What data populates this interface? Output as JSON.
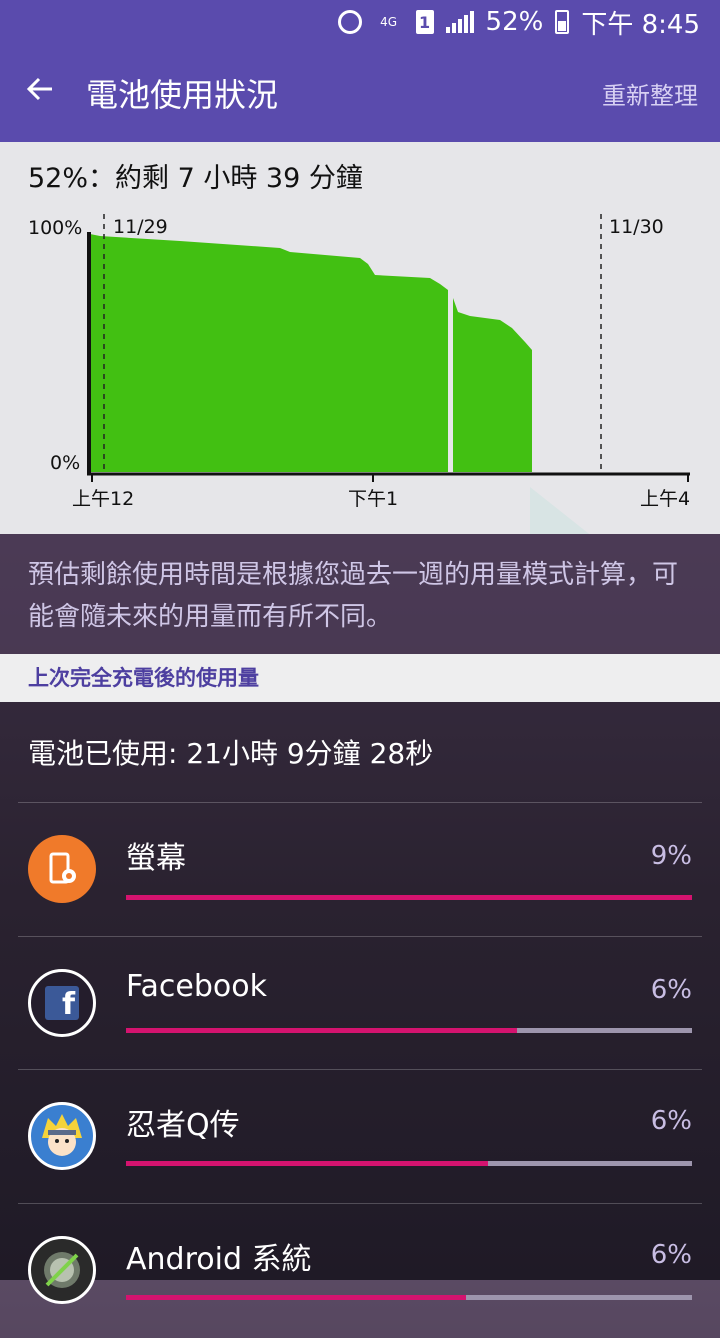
{
  "status_bar": {
    "network": "4G",
    "sim": "1",
    "battery_percent": "52%",
    "time": "下午 8:45",
    "icons": [
      "alarm-icon",
      "wifi-4g-icon",
      "sim-icon",
      "signal-icon",
      "battery-icon"
    ]
  },
  "app_bar": {
    "back_icon": "back-arrow-icon",
    "title": "電池使用狀況",
    "refresh_label": "重新整理"
  },
  "summary": "52%：約剩 7 小時 39 分鐘",
  "chart_data": {
    "type": "area",
    "y_ticks": [
      "100%",
      "0%"
    ],
    "x_ticks": [
      "上午12",
      "下午1",
      "上午4"
    ],
    "date_markers": [
      "11/29",
      "11/30"
    ],
    "colors": {
      "actual": "#42c012",
      "projection": "#d8e4e4"
    }
  },
  "note": "預估剩餘使用時間是根據您過去一週的用量模式計算，可能會隨未來的用量而有所不同。",
  "section_title": "上次完全充電後的使用量",
  "battery_used": "電池已使用: 21小時 9分鐘 28秒",
  "apps": [
    {
      "name": "螢幕",
      "percent": "9%",
      "fraction": 1.0,
      "icon": "screen-settings-icon"
    },
    {
      "name": "Facebook",
      "percent": "6%",
      "fraction": 0.69,
      "icon": "facebook-icon"
    },
    {
      "name": "忍者Q传",
      "percent": "6%",
      "fraction": 0.64,
      "icon": "ninja-game-icon"
    },
    {
      "name": "Android 系統",
      "percent": "6%",
      "fraction": 0.6,
      "icon": "android-system-icon"
    }
  ]
}
